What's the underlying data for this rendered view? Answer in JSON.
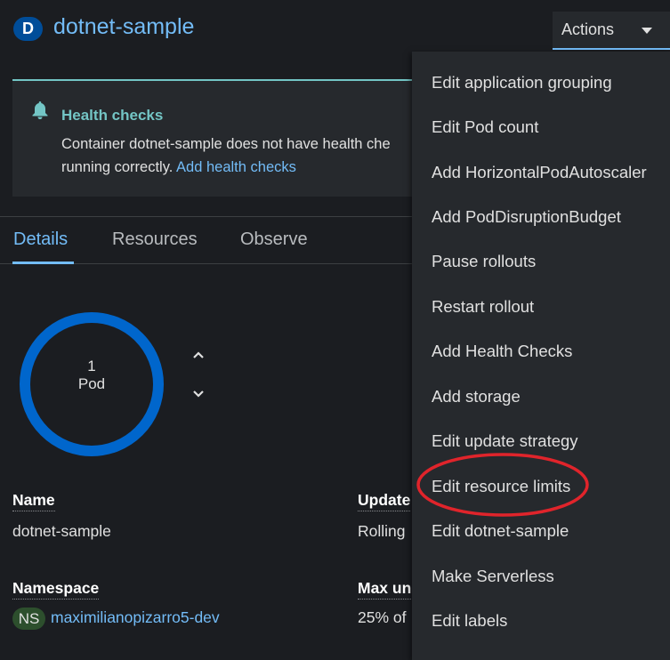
{
  "header": {
    "resource_badge": "D",
    "title": "dotnet-sample",
    "actions_label": "Actions"
  },
  "alert": {
    "title": "Health checks",
    "body": "Container dotnet-sample does not have health checks to ensure your application is running correctly.",
    "body_visible": "Container dotnet-sample does not have health che",
    "body_line2": "running correctly.",
    "link": "Add health checks"
  },
  "tabs": [
    {
      "label": "Details",
      "active": true
    },
    {
      "label": "Resources",
      "active": false
    },
    {
      "label": "Observe",
      "active": false
    }
  ],
  "pod": {
    "count": "1",
    "label": "Pod",
    "ring_color": "#0066cc"
  },
  "details": {
    "name_label": "Name",
    "name_value": "dotnet-sample",
    "namespace_label": "Namespace",
    "namespace_badge": "NS",
    "namespace_value": "maximilianopizarro5-dev",
    "update_label": "Update",
    "update_value": "Rolling",
    "max_label": "Max un",
    "max_value": "25% of"
  },
  "menu": {
    "items": [
      "Edit application grouping",
      "Edit Pod count",
      "Add HorizontalPodAutoscaler",
      "Add PodDisruptionBudget",
      "Pause rollouts",
      "Restart rollout",
      "Add Health Checks",
      "Add storage",
      "Edit update strategy",
      "Edit resource limits",
      "Edit dotnet-sample",
      "Make Serverless",
      "Edit labels"
    ],
    "highlighted_item": "Edit resource limits",
    "highlight_color": "#e0242b"
  },
  "colors": {
    "accent": "#73bcf7",
    "background": "#1b1d21",
    "panel": "#26292d",
    "alert_accent": "#73c5c5"
  }
}
